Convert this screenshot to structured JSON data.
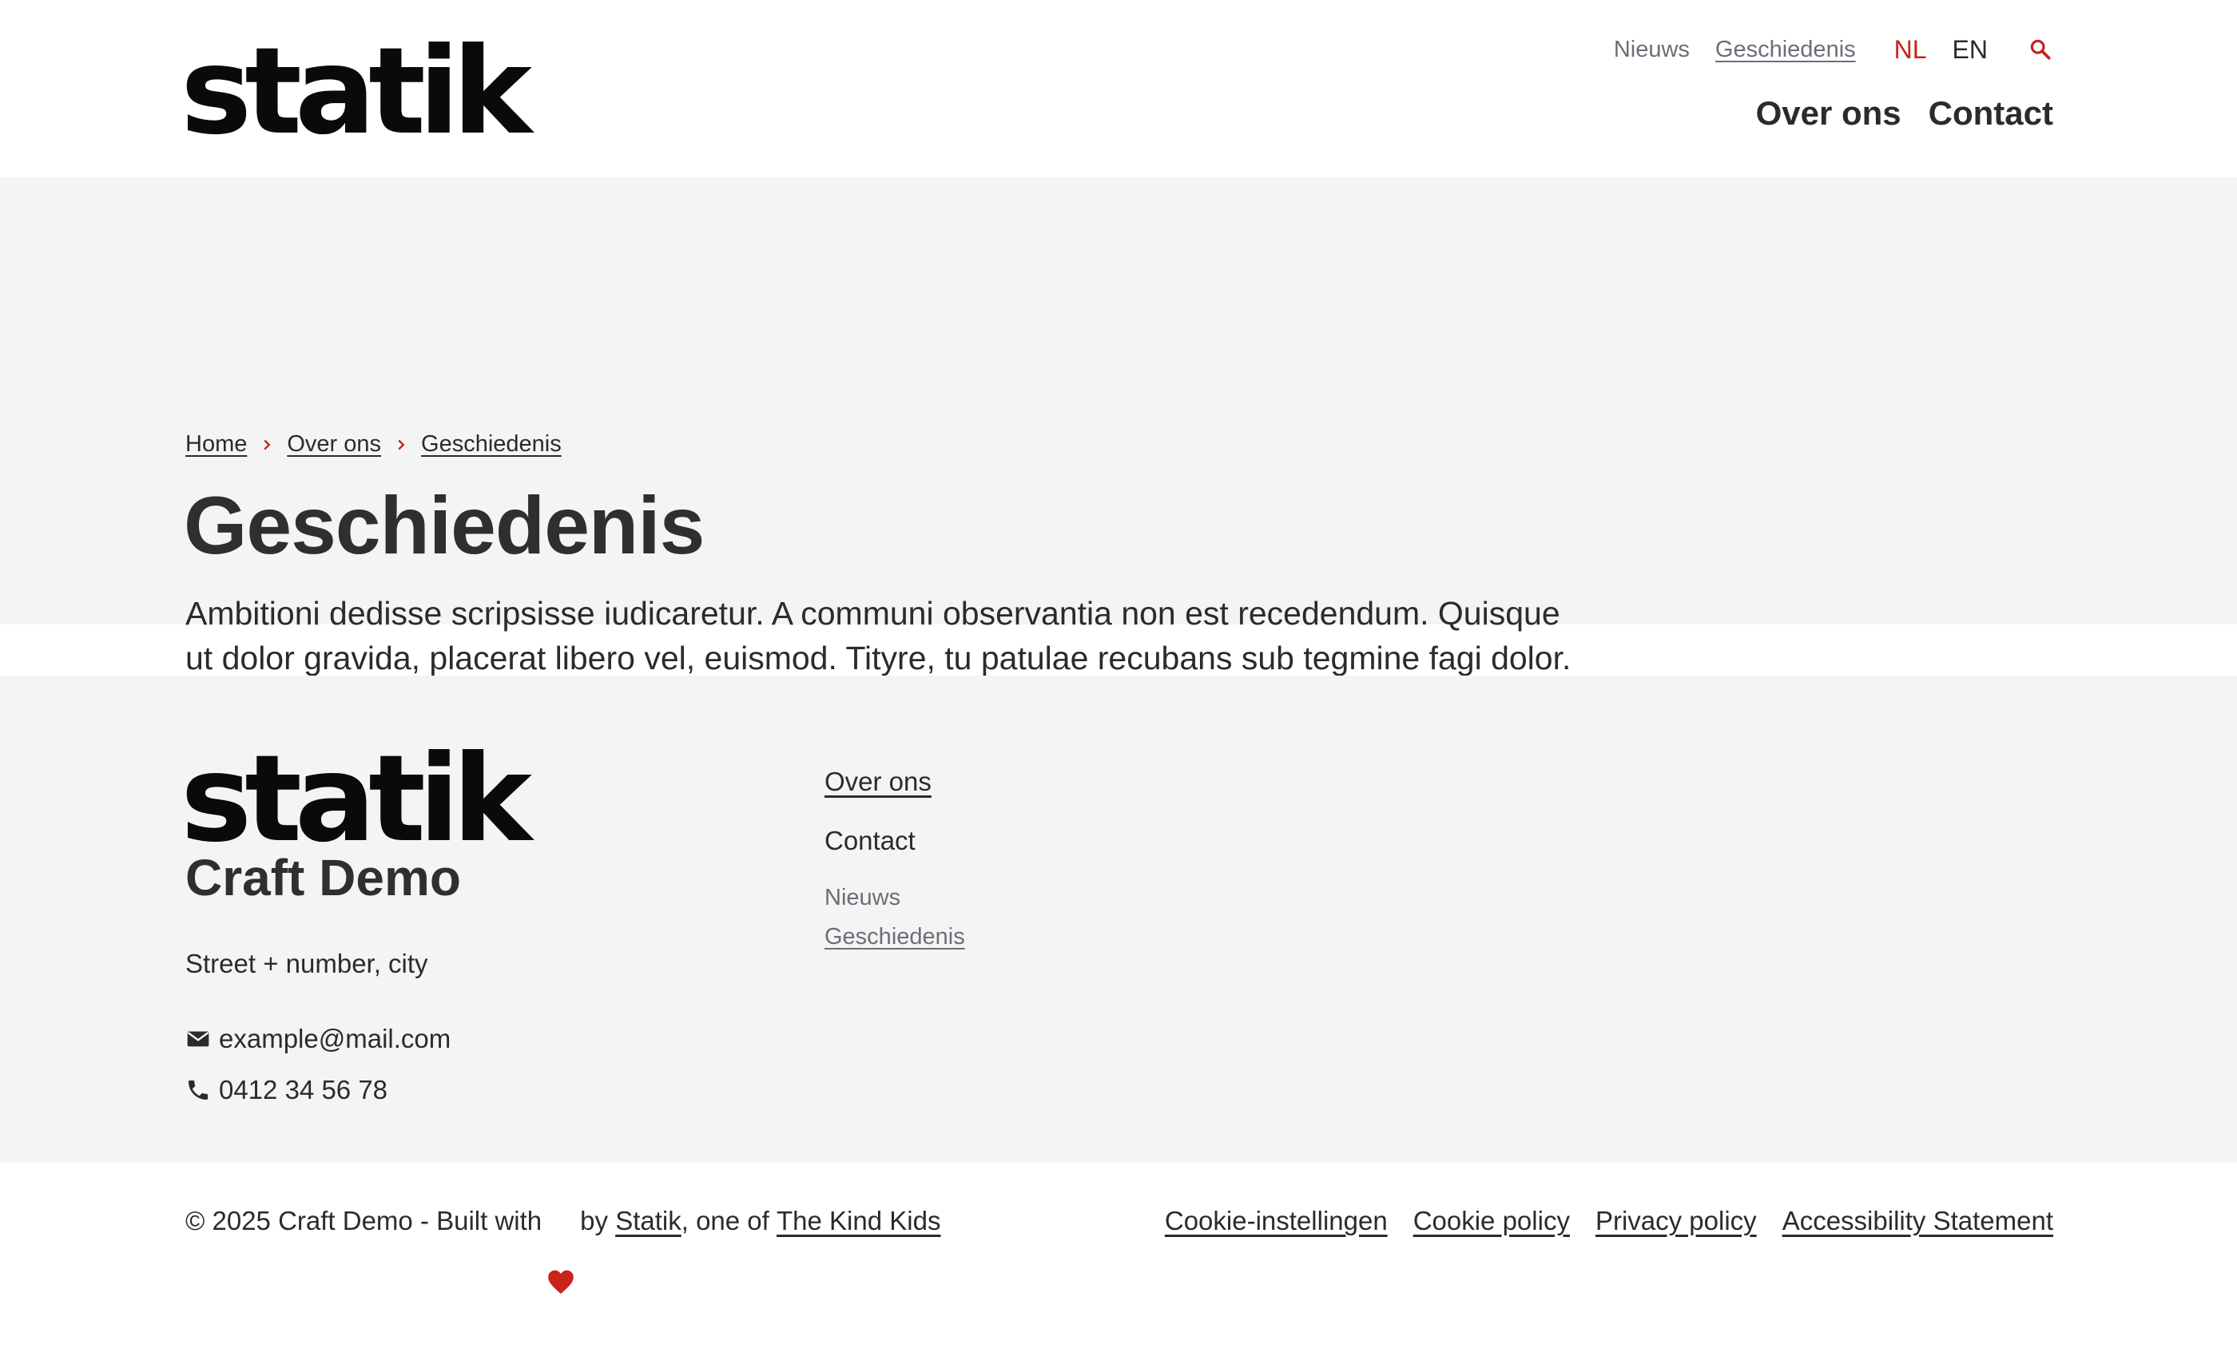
{
  "header": {
    "logo": "statik",
    "service_nav": [
      {
        "label": "Nieuws",
        "active": false
      },
      {
        "label": "Geschiedenis",
        "active": true
      }
    ],
    "languages": {
      "nl": "NL",
      "en": "EN",
      "active": "NL"
    },
    "search_icon": "search-icon",
    "main_nav": [
      {
        "label": "Over ons"
      },
      {
        "label": "Contact"
      }
    ]
  },
  "hero": {
    "breadcrumb": [
      "Home",
      "Over ons",
      "Geschiedenis"
    ],
    "title": "Geschiedenis",
    "intro": "Ambitioni dedisse scripsisse iudicaretur. A communi observantia non est recedendum. Quisque ut dolor gravida, placerat libero vel, euismod. Tityre, tu patulae recubans sub tegmine fagi dolor. Quis aute iure reprehenderit in voluptate velit esse."
  },
  "footer": {
    "logo": "statik",
    "company": "Craft Demo",
    "address": "Street + number, city",
    "email": "example@mail.com",
    "phone": "0412 34 56 78",
    "nav": {
      "main": [
        "Over ons",
        "Contact"
      ],
      "sub": [
        "Nieuws",
        "Geschiedenis"
      ]
    }
  },
  "bottom": {
    "copyright_prefix": "© 2025 Craft Demo - Built with",
    "by": "by",
    "statik": "Statik",
    "one_of": ", one of",
    "kind_kids": "The Kind Kids",
    "legal": [
      "Cookie-instellingen",
      "Cookie policy",
      "Privacy policy",
      "Accessibility Statement"
    ]
  },
  "colors": {
    "accent": "#c9231c",
    "text": "#2b2b2b",
    "muted": "#6a6f77",
    "panel_bg": "#f4f4f4"
  }
}
